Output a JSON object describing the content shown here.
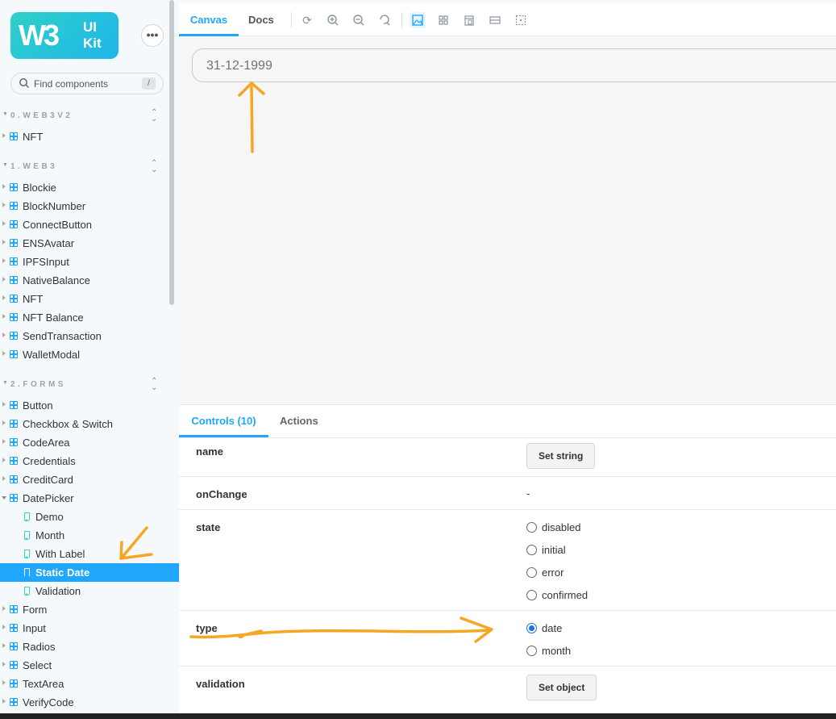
{
  "sidebar": {
    "logo_mark": "W3",
    "logo_ui": "UI",
    "logo_kit": "Kit",
    "menu_label": "•••",
    "search_placeholder": "Find components",
    "search_shortcut": "/",
    "groups": [
      {
        "title": "0.WEB3V2",
        "items": [
          "NFT"
        ]
      },
      {
        "title": "1.WEB3",
        "items": [
          "Blockie",
          "BlockNumber",
          "ConnectButton",
          "ENSAvatar",
          "IPFSInput",
          "NativeBalance",
          "NFT",
          "NFT Balance",
          "SendTransaction",
          "WalletModal"
        ]
      },
      {
        "title": "2.FORMS",
        "items": [
          "Button",
          "Checkbox & Switch",
          "CodeArea",
          "Credentials",
          "CreditCard",
          "DatePicker"
        ]
      }
    ],
    "datepicker_stories": [
      "Demo",
      "Month",
      "With Label",
      "Static Date",
      "Validation"
    ],
    "forms_after": [
      "Form",
      "Input",
      "Radios",
      "Select",
      "TextArea",
      "VerifyCode"
    ],
    "active_story": "Static Date"
  },
  "toolbar": {
    "tab_canvas": "Canvas",
    "tab_docs": "Docs",
    "icons": [
      "refresh-icon",
      "zoom-in-icon",
      "zoom-out-icon",
      "reset-zoom-icon",
      "background-icon",
      "grid-icon",
      "viewport-icon",
      "measure-icon",
      "outline-icon"
    ]
  },
  "canvas": {
    "date_value": "31-12-1999"
  },
  "addons": {
    "tab_controls": "Controls (10)",
    "tab_actions": "Actions",
    "rows": {
      "name": {
        "label": "name",
        "button": "Set string"
      },
      "onChange": {
        "label": "onChange",
        "value": "-"
      },
      "state": {
        "label": "state",
        "options": [
          "disabled",
          "initial",
          "error",
          "confirmed"
        ]
      },
      "type": {
        "label": "type",
        "options": [
          "date",
          "month"
        ],
        "selected": "date"
      },
      "validation": {
        "label": "validation",
        "button": "Set object"
      }
    }
  },
  "colors": {
    "accent": "#1ea7fd",
    "annotation": "#f5a623"
  }
}
